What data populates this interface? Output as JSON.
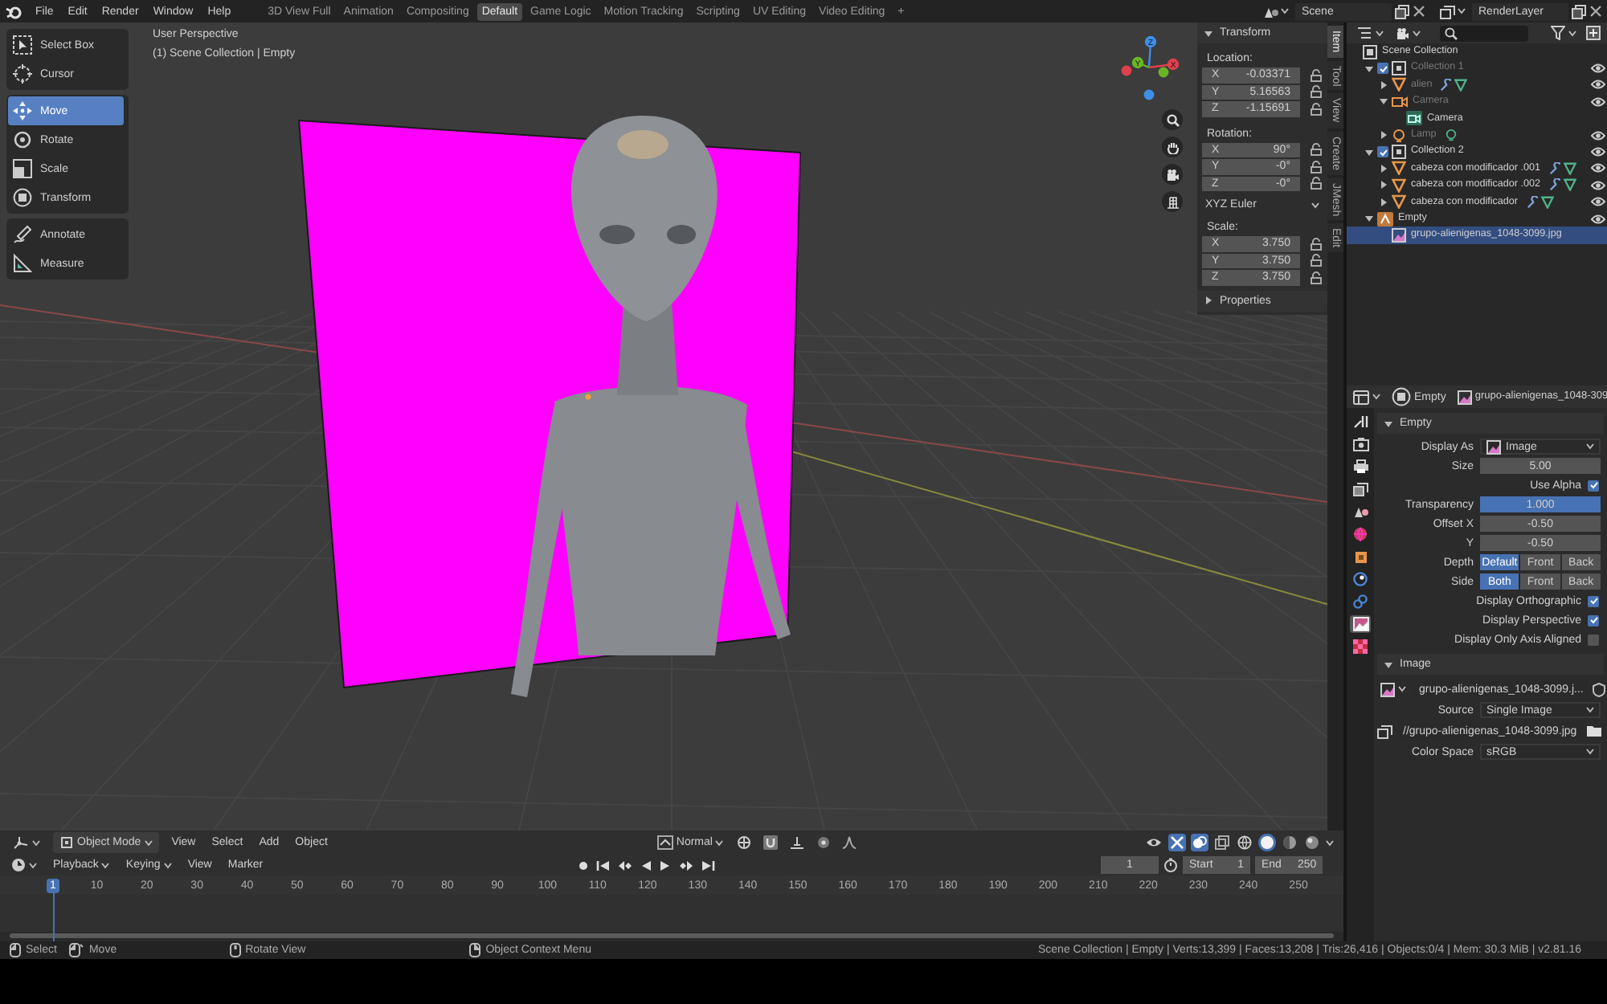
{
  "topbar": {
    "menus": [
      "File",
      "Edit",
      "Render",
      "Window",
      "Help"
    ],
    "workspaces": [
      {
        "label": "3D View Full",
        "selected": false
      },
      {
        "label": "Animation",
        "selected": false
      },
      {
        "label": "Compositing",
        "selected": false
      },
      {
        "label": "Default",
        "selected": true
      },
      {
        "label": "Game Logic",
        "selected": false
      },
      {
        "label": "Motion Tracking",
        "selected": false
      },
      {
        "label": "Scripting",
        "selected": false
      },
      {
        "label": "UV Editing",
        "selected": false
      },
      {
        "label": "Video Editing",
        "selected": false
      }
    ],
    "add_workspace": "+",
    "scene": "Scene",
    "view_layer": "RenderLayer"
  },
  "toolbar": [
    {
      "tools": [
        {
          "label": "Select Box",
          "kind": "select",
          "selected": false
        },
        {
          "label": "Cursor",
          "kind": "cursor",
          "selected": false
        }
      ]
    },
    {
      "tools": [
        {
          "label": "Move",
          "kind": "move",
          "selected": true
        },
        {
          "label": "Rotate",
          "kind": "rotate",
          "selected": false
        },
        {
          "label": "Scale",
          "kind": "scale",
          "selected": false
        },
        {
          "label": "Transform",
          "kind": "transform",
          "selected": false
        }
      ]
    },
    {
      "tools": [
        {
          "label": "Annotate",
          "kind": "annotate",
          "selected": false
        },
        {
          "label": "Measure",
          "kind": "measure",
          "selected": false
        }
      ]
    }
  ],
  "viewport": {
    "view_name": "User Perspective",
    "context": "(1) Scene Collection | Empty",
    "gizmo_labels": [
      "Z",
      "Y",
      "X"
    ]
  },
  "sidebar": {
    "transform": {
      "title": "Transform",
      "expanded": true,
      "location": {
        "label": "Location:",
        "fields": [
          {
            "axis": "X",
            "value": "-0.03371"
          },
          {
            "axis": "Y",
            "value": "5.16563"
          },
          {
            "axis": "Z",
            "value": "-1.15691"
          }
        ]
      },
      "rotation": {
        "label": "Rotation:",
        "fields": [
          {
            "axis": "X",
            "value": "90°"
          },
          {
            "axis": "Y",
            "value": "-0°"
          },
          {
            "axis": "Z",
            "value": "-0°"
          }
        ]
      },
      "rotation_mode": "XYZ Euler",
      "scale": {
        "label": "Scale:",
        "fields": [
          {
            "axis": "X",
            "value": "3.750"
          },
          {
            "axis": "Y",
            "value": "3.750"
          },
          {
            "axis": "Z",
            "value": "3.750"
          }
        ]
      }
    },
    "properties": {
      "title": "Properties",
      "expanded": false
    },
    "tabs": [
      {
        "label": "Item",
        "selected": true
      },
      {
        "label": "Tool",
        "selected": false
      },
      {
        "label": "View",
        "selected": false
      },
      {
        "label": "Create",
        "selected": false
      },
      {
        "label": "JMesh",
        "selected": false
      },
      {
        "label": "Edit",
        "selected": false
      }
    ]
  },
  "viewport_header": {
    "mode": "Object Mode",
    "menus": [
      "View",
      "Select",
      "Add",
      "Object"
    ],
    "orientation": "Normal",
    "shading": [
      {
        "kind": "wireframe",
        "selected": false
      },
      {
        "kind": "solid",
        "selected": true
      },
      {
        "kind": "material",
        "selected": false
      },
      {
        "kind": "rendered",
        "selected": false
      }
    ]
  },
  "timeline": {
    "menus": [
      {
        "label": "Playback",
        "kind": "dropdown"
      },
      {
        "label": "Keying",
        "kind": "dropdown"
      },
      {
        "label": "View",
        "kind": "menu"
      },
      {
        "label": "Marker",
        "kind": "menu"
      }
    ],
    "current_frame": "1",
    "start_label": "Start",
    "start": "1",
    "end_label": "End",
    "end": "250",
    "ruler": [
      {
        "label": "1",
        "selected": true
      },
      {
        "label": "10",
        "selected": false
      },
      {
        "label": "20",
        "selected": false
      },
      {
        "label": "30",
        "selected": false
      },
      {
        "label": "40",
        "selected": false
      },
      {
        "label": "50",
        "selected": false
      },
      {
        "label": "60",
        "selected": false
      },
      {
        "label": "70",
        "selected": false
      },
      {
        "label": "80",
        "selected": false
      },
      {
        "label": "90",
        "selected": false
      },
      {
        "label": "100",
        "selected": false
      },
      {
        "label": "110",
        "selected": false
      },
      {
        "label": "120",
        "selected": false
      },
      {
        "label": "130",
        "selected": false
      },
      {
        "label": "140",
        "selected": false
      },
      {
        "label": "150",
        "selected": false
      },
      {
        "label": "160",
        "selected": false
      },
      {
        "label": "170",
        "selected": false
      },
      {
        "label": "180",
        "selected": false
      },
      {
        "label": "190",
        "selected": false
      },
      {
        "label": "200",
        "selected": false
      },
      {
        "label": "210",
        "selected": false
      },
      {
        "label": "220",
        "selected": false
      },
      {
        "label": "230",
        "selected": false
      },
      {
        "label": "240",
        "selected": false
      },
      {
        "label": "250",
        "selected": false
      }
    ]
  },
  "outliner": {
    "tree": [
      {
        "label": "Scene Collection",
        "kind": "scene_collection",
        "selected": false,
        "dimmed": false,
        "eye": false,
        "children": [
          {
            "label": "Collection 1",
            "kind": "collection",
            "expanded": true,
            "checked": true,
            "selected": false,
            "dimmed": true,
            "eye": true,
            "children": [
              {
                "label": "alien",
                "kind": "mesh",
                "expanded": false,
                "selected": false,
                "dimmed": true,
                "eye": true,
                "badges": [
                  {
                    "kind": "modifier"
                  },
                  {
                    "kind": "mesh_data"
                  }
                ]
              },
              {
                "label": "Camera",
                "kind": "camera",
                "expanded": true,
                "selected": false,
                "dimmed": true,
                "eye": true,
                "children": [
                  {
                    "label": "Camera",
                    "kind": "camera_data",
                    "selected": false,
                    "dimmed": false,
                    "eye": false
                  }
                ]
              },
              {
                "label": "Lamp",
                "kind": "light",
                "expanded": false,
                "selected": false,
                "dimmed": true,
                "eye": true,
                "badges": [
                  {
                    "kind": "light_data"
                  }
                ]
              }
            ]
          },
          {
            "label": "Collection 2",
            "kind": "collection",
            "expanded": true,
            "checked": true,
            "selected": false,
            "dimmed": false,
            "eye": true,
            "children": [
              {
                "label": "cabeza con modificador .001",
                "kind": "mesh",
                "expanded": false,
                "selected": false,
                "dimmed": false,
                "eye": true,
                "badges": [
                  {
                    "kind": "modifier"
                  },
                  {
                    "kind": "mesh_data"
                  }
                ]
              },
              {
                "label": "cabeza con modificador .002",
                "kind": "mesh",
                "expanded": false,
                "selected": false,
                "dimmed": false,
                "eye": true,
                "badges": [
                  {
                    "kind": "modifier"
                  },
                  {
                    "kind": "mesh_data"
                  }
                ]
              },
              {
                "label": "cabeza con modificador",
                "kind": "mesh",
                "expanded": false,
                "selected": false,
                "dimmed": false,
                "eye": true,
                "badges": [
                  {
                    "kind": "modifier"
                  },
                  {
                    "kind": "mesh_data"
                  }
                ]
              }
            ]
          },
          {
            "label": "Empty",
            "kind": "empty",
            "expanded": true,
            "selected": false,
            "dimmed": false,
            "eye": true,
            "children": [
              {
                "label": "grupo-alienigenas_1048-3099.jpg",
                "kind": "image",
                "selected": true,
                "dimmed": false,
                "eye": false
              }
            ]
          }
        ]
      }
    ]
  },
  "properties": {
    "header": {
      "object": "Empty",
      "data": "grupo-alienigenas_1048-309"
    },
    "tabs": [
      {
        "kind": "tool",
        "selected": false
      },
      {
        "kind": "render",
        "selected": false
      },
      {
        "kind": "output",
        "selected": false
      },
      {
        "kind": "view_layer",
        "selected": false
      },
      {
        "kind": "scene",
        "selected": false
      },
      {
        "kind": "world",
        "selected": false
      },
      {
        "kind": "object",
        "selected": false
      },
      {
        "kind": "physics",
        "selected": false
      },
      {
        "kind": "constraints",
        "selected": false
      },
      {
        "kind": "data",
        "selected": true
      },
      {
        "kind": "texture",
        "selected": false
      }
    ],
    "panels": [
      {
        "title": "Empty",
        "expanded": true,
        "rows": [
          {
            "kind": "icon_dropdown",
            "label": "Display As",
            "value": "Image"
          },
          {
            "kind": "number",
            "label": "Size",
            "value": "5.00"
          },
          {
            "kind": "checkbox",
            "label": "Use Alpha",
            "checked": true
          },
          {
            "kind": "slider",
            "label": "Transparency",
            "value": "1.000",
            "level": 1
          },
          {
            "kind": "number",
            "label": "Offset X",
            "value": "-0.50"
          },
          {
            "kind": "number",
            "label": "Y",
            "value": "-0.50"
          },
          {
            "kind": "segmented",
            "label": "Depth",
            "options": [
              {
                "label": "Default",
                "selected": true
              },
              {
                "label": "Front",
                "selected": false
              },
              {
                "label": "Back",
                "selected": false
              }
            ]
          },
          {
            "kind": "segmented",
            "label": "Side",
            "options": [
              {
                "label": "Both",
                "selected": true
              },
              {
                "label": "Front",
                "selected": false
              },
              {
                "label": "Back",
                "selected": false
              }
            ]
          },
          {
            "kind": "checkbox",
            "label": "Display Orthographic",
            "checked": true
          },
          {
            "kind": "checkbox",
            "label": "Display Perspective",
            "checked": true
          },
          {
            "kind": "checkbox",
            "label": "Display Only Axis Aligned",
            "checked": false
          }
        ]
      },
      {
        "title": "Image",
        "expanded": true,
        "rows": [
          {
            "kind": "image_selector",
            "value": "grupo-alienigenas_1048-3099.j..."
          },
          {
            "kind": "dropdown",
            "label": "Source",
            "value": "Single Image"
          },
          {
            "kind": "filepath",
            "value": "//grupo-alienigenas_1048-3099.jpg"
          },
          {
            "kind": "dropdown",
            "label": "Color Space",
            "value": "sRGB"
          }
        ]
      }
    ]
  },
  "status_bar": {
    "hints": [
      {
        "kind": "mouse_left",
        "label": "Select"
      },
      {
        "kind": "mouse_drag",
        "label": "Move"
      },
      {
        "kind": "mouse_middle",
        "label": "Rotate View"
      },
      {
        "kind": "mouse_right",
        "label": "Object Context Menu"
      }
    ],
    "stats": "Scene Collection | Empty | Verts:13,399 | Faces:13,208 | Tris:26,416 | Objects:0/4 | Mem: 30.3 MiB | v2.81.16"
  }
}
